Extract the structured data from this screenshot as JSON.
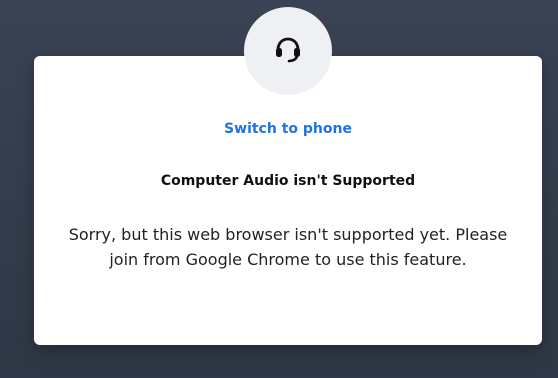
{
  "dialog": {
    "icon": "headset-icon",
    "switch_label": "Switch to phone",
    "title": "Computer Audio isn't Supported",
    "message": "Sorry, but this web browser isn't supported yet. Please join from Google Chrome to use this feature."
  },
  "colors": {
    "backdrop": "#3a4354",
    "card": "#ffffff",
    "icon_circle": "#eef0f4",
    "link": "#1f73e6",
    "text": "#222222"
  }
}
